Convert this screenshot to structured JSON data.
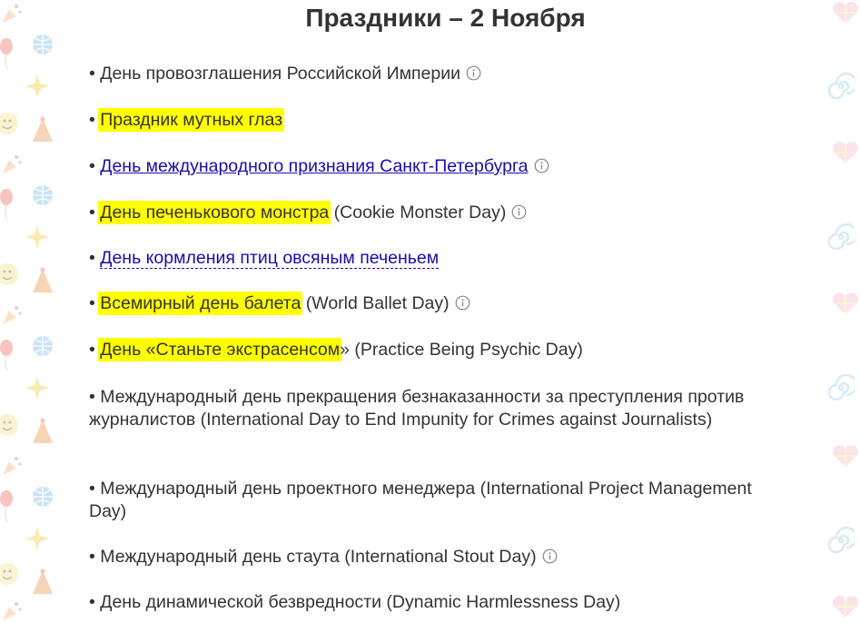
{
  "page": {
    "title": "Праздники – 2 Ноября"
  },
  "holidays": [
    {
      "bullet": "• ",
      "highlight": "",
      "link": "",
      "dotted_link": "",
      "text": "День провозглашения Российской Империи",
      "has_info": true
    },
    {
      "bullet": "• ",
      "highlight": "Праздник мутных глаз",
      "link": "",
      "dotted_link": "",
      "text": "",
      "has_info": false
    },
    {
      "bullet": "• ",
      "highlight": "",
      "link": "День международного признания Санкт-Петербурга",
      "dotted_link": "",
      "text": "",
      "has_info": true
    },
    {
      "bullet": "• ",
      "highlight": "День печенькового монстра",
      "link": "",
      "dotted_link": "",
      "text": " (Cookie Monster Day)",
      "has_info": true
    },
    {
      "bullet": "• ",
      "highlight": "",
      "link": "",
      "dotted_link": "День кормления птиц овсяным печеньем",
      "text": "",
      "has_info": false
    },
    {
      "bullet": "• ",
      "highlight": "Всемирный день балета",
      "link": "",
      "dotted_link": "",
      "text": " (World Ballet Day)",
      "has_info": true
    },
    {
      "bullet": "• ",
      "highlight": "День «Станьте экстрасенсом",
      "link": "",
      "dotted_link": "",
      "text": "» (Practice Being Psychic Day)",
      "has_info": false
    },
    {
      "bullet": "• ",
      "highlight": "",
      "link": "",
      "dotted_link": "",
      "text": "Международный день прекращения безнаказанности за преступления против журналистов (International Day to End Impunity for Crimes against Journalists)",
      "has_info": false
    },
    {
      "bullet": "• ",
      "highlight": "",
      "link": "",
      "dotted_link": "",
      "text": "Международный день проектного менеджера (International Project Management Day)",
      "has_info": false
    },
    {
      "bullet": "• ",
      "highlight": "",
      "link": "",
      "dotted_link": "",
      "text": "Международный день стаута (International Stout Day)",
      "has_info": true
    },
    {
      "bullet": "• ",
      "highlight": "",
      "link": "",
      "dotted_link": "",
      "text": "День динамической безвредности (Dynamic Harmlessness Day)",
      "has_info": false
    }
  ],
  "icons": {
    "info": "info-circle-icon"
  },
  "colors": {
    "text": "#333333",
    "link": "#1a0dab",
    "highlight": "#ffff00",
    "icon": "#888888"
  }
}
